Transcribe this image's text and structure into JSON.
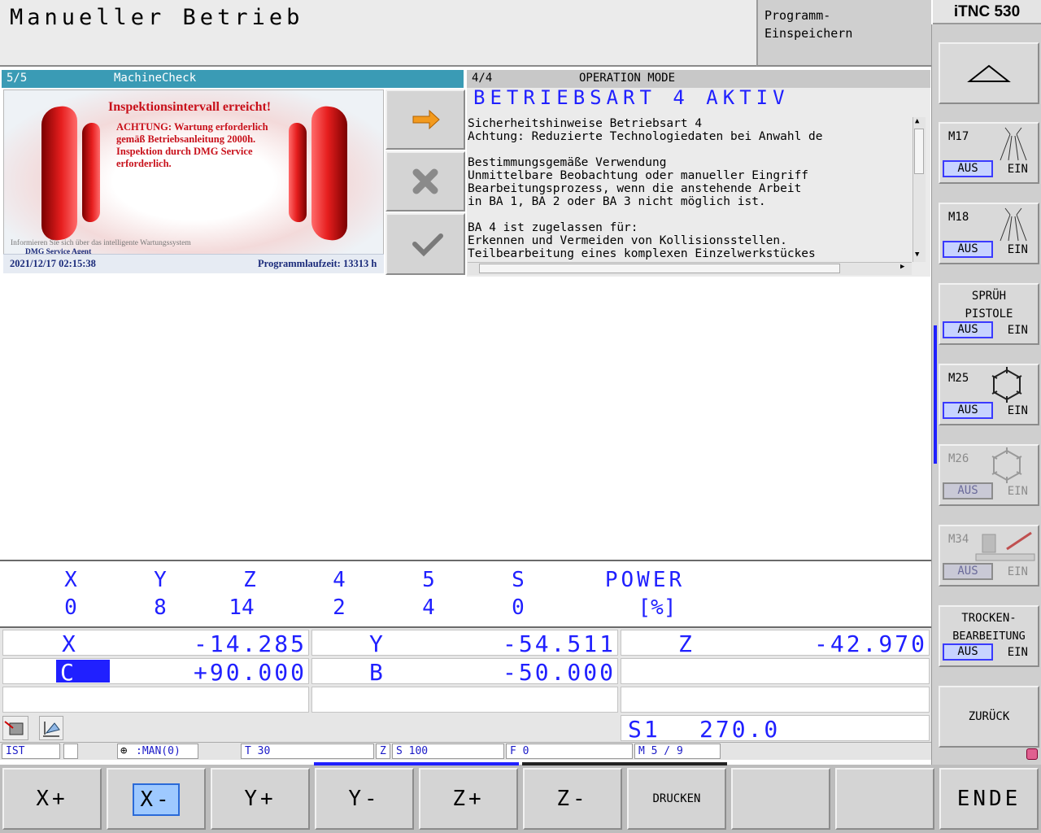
{
  "header": {
    "title": "Manueller Betrieb",
    "program_line1": "Programm-",
    "program_line2": "Einspeichern",
    "brand": "iTNC 530"
  },
  "machine_check": {
    "page": "5/5",
    "title": "MachineCheck",
    "headline": "Inspektionsintervall erreicht!",
    "msg_line1": "ACHTUNG: Wartung erforderlich",
    "msg_line2": "gemäß Betriebsanleitung 2000h.",
    "msg_line3": "Inspektion durch DMG Service",
    "msg_line4": "erforderlich.",
    "info": "Informieren Sie sich über das intelligente Wartungssystem",
    "agent": "DMG Service Agent",
    "timestamp": "2021/12/17 02:15:38",
    "runtime": "Programmlaufzeit: 13313 h"
  },
  "operation_mode": {
    "page": "4/4",
    "title": "OPERATION MODE",
    "banner": "BETRIEBSART 4 AKTIV",
    "text": "Sicherheitshinweise Betriebsart 4\nAchtung: Reduzierte Technologiedaten bei Anwahl de\n\nBestimmungsgemäße Verwendung\nUnmittelbare Beobachtung oder manueller Eingriff\nBearbeitungsprozess, wenn die anstehende Arbeit\nin BA 1, BA 2 oder BA 3 nicht möglich ist.\n\nBA 4 ist zugelassen für:\nErkennen und Vermeiden von Kollisionsstellen.\nTeilbearbeitung eines komplexen Einzelwerkstückes"
  },
  "load_display": {
    "headers": [
      "X",
      "Y",
      "Z",
      "4",
      "5",
      "S",
      "POWER"
    ],
    "values": [
      "0",
      "8",
      "14",
      "2",
      "4",
      "0",
      "[%]"
    ]
  },
  "positions": {
    "x_label": "X",
    "x_value": "-14.285",
    "y_label": "Y",
    "y_value": "-54.511",
    "z_label": "Z",
    "z_value": "-42.970",
    "c_label": "C",
    "c_value": "+90.000",
    "b_label": "B",
    "b_value": "-50.000",
    "spindle": "S1",
    "spindle_value": "270.0"
  },
  "status": {
    "ist": "IST",
    "man": ":MAN(0)",
    "t": "T  30",
    "z": "Z",
    "s": "S 100",
    "f": "F  0",
    "m": "M 5 / 9"
  },
  "right_softkeys": {
    "m17": "M17",
    "m18": "M18",
    "spray_line1": "SPRÜH",
    "spray_line2": "PISTOLE",
    "m25": "M25",
    "m26": "M26",
    "m34": "M34",
    "dry_line1": "TROCKEN-",
    "dry_line2": "BEARBEITUNG",
    "aus": "AUS",
    "ein": "EIN",
    "back": "ZURÜCK"
  },
  "bottom_softkeys": [
    "X+",
    "X-",
    "Y+",
    "Y-",
    "Z+",
    "Z-",
    "DRUCKEN",
    "",
    "",
    "ENDE"
  ],
  "colors": {
    "axis_blue": "#2020ff",
    "mc_header": "#3a9bb5",
    "warning_red": "#c8101a",
    "selected_bg": "#2020ff"
  }
}
